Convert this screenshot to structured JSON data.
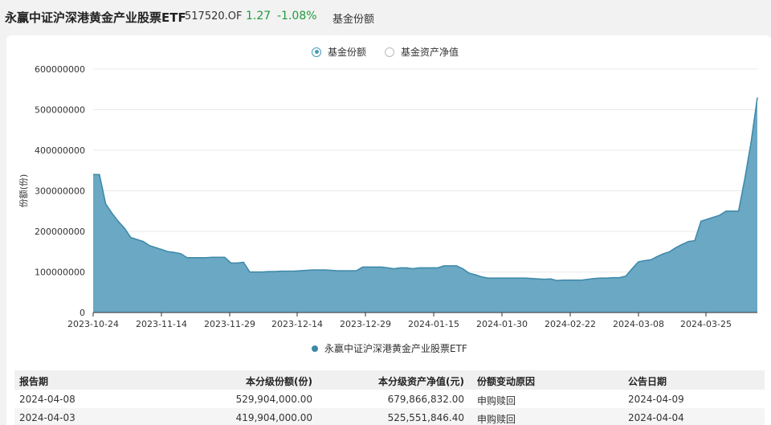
{
  "header": {
    "fund_name": "永赢中证沪深港黄金产业股票ETF",
    "fund_code": "517520.OF",
    "price": "1.27",
    "change": "-1.08%",
    "tab": "基金份额",
    "price_color": "#1f9a3a"
  },
  "toggles": [
    {
      "label": "基金份额",
      "active": true
    },
    {
      "label": "基金资产净值",
      "active": false
    }
  ],
  "chart_data": {
    "type": "area",
    "ylabel": "份额(份)",
    "ylim": [
      0,
      600000000
    ],
    "yticks": [
      "0",
      "100000000",
      "200000000",
      "300000000",
      "400000000",
      "500000000",
      "600000000"
    ],
    "xtick_labels": [
      "2023-10-24",
      "2023-11-14",
      "2023-11-29",
      "2023-12-14",
      "2023-12-29",
      "2024-01-15",
      "2024-01-30",
      "2024-02-22",
      "2024-03-08",
      "2024-03-25"
    ],
    "series": [
      {
        "name": "永赢中证沪深港黄金产业股票ETF",
        "color": "#3d88a8",
        "fill": "#6aa8c4",
        "values": [
          340,
          340,
          268,
          245,
          225,
          208,
          185,
          180,
          175,
          165,
          160,
          155,
          150,
          148,
          145,
          135,
          135,
          135,
          135,
          136,
          136,
          136,
          122,
          122,
          124,
          100,
          100,
          100,
          101,
          101,
          102,
          102,
          102,
          103,
          104,
          105,
          105,
          105,
          104,
          103,
          103,
          103,
          103,
          112,
          112,
          112,
          112,
          110,
          108,
          110,
          110,
          108,
          110,
          110,
          110,
          110,
          115,
          115,
          115,
          108,
          97,
          93,
          88,
          85,
          85,
          85,
          85,
          85,
          85,
          85,
          84,
          83,
          82,
          83,
          79,
          80,
          80,
          80,
          80,
          82,
          84,
          85,
          85,
          86,
          86,
          90,
          108,
          125,
          128,
          130,
          138,
          145,
          150,
          160,
          168,
          175,
          177,
          225,
          230,
          235,
          240,
          250,
          250,
          250,
          330,
          420,
          530
        ]
      }
    ],
    "value_unit_multiplier": 1000000
  },
  "legend": {
    "label": "永赢中证沪深港黄金产业股票ETF",
    "color": "#3d88a8"
  },
  "table": {
    "headers": [
      "报告期",
      "本分级份额(份)",
      "本分级资产净值(元)",
      "份额变动原因",
      "公告日期"
    ],
    "rows": [
      [
        "2024-04-08",
        "529,904,000.00",
        "679,866,832.00",
        "申购赎回",
        "2024-04-09"
      ],
      [
        "2024-04-03",
        "419,904,000.00",
        "525,551,846.40",
        "申购赎回",
        "2024-04-04"
      ]
    ]
  }
}
